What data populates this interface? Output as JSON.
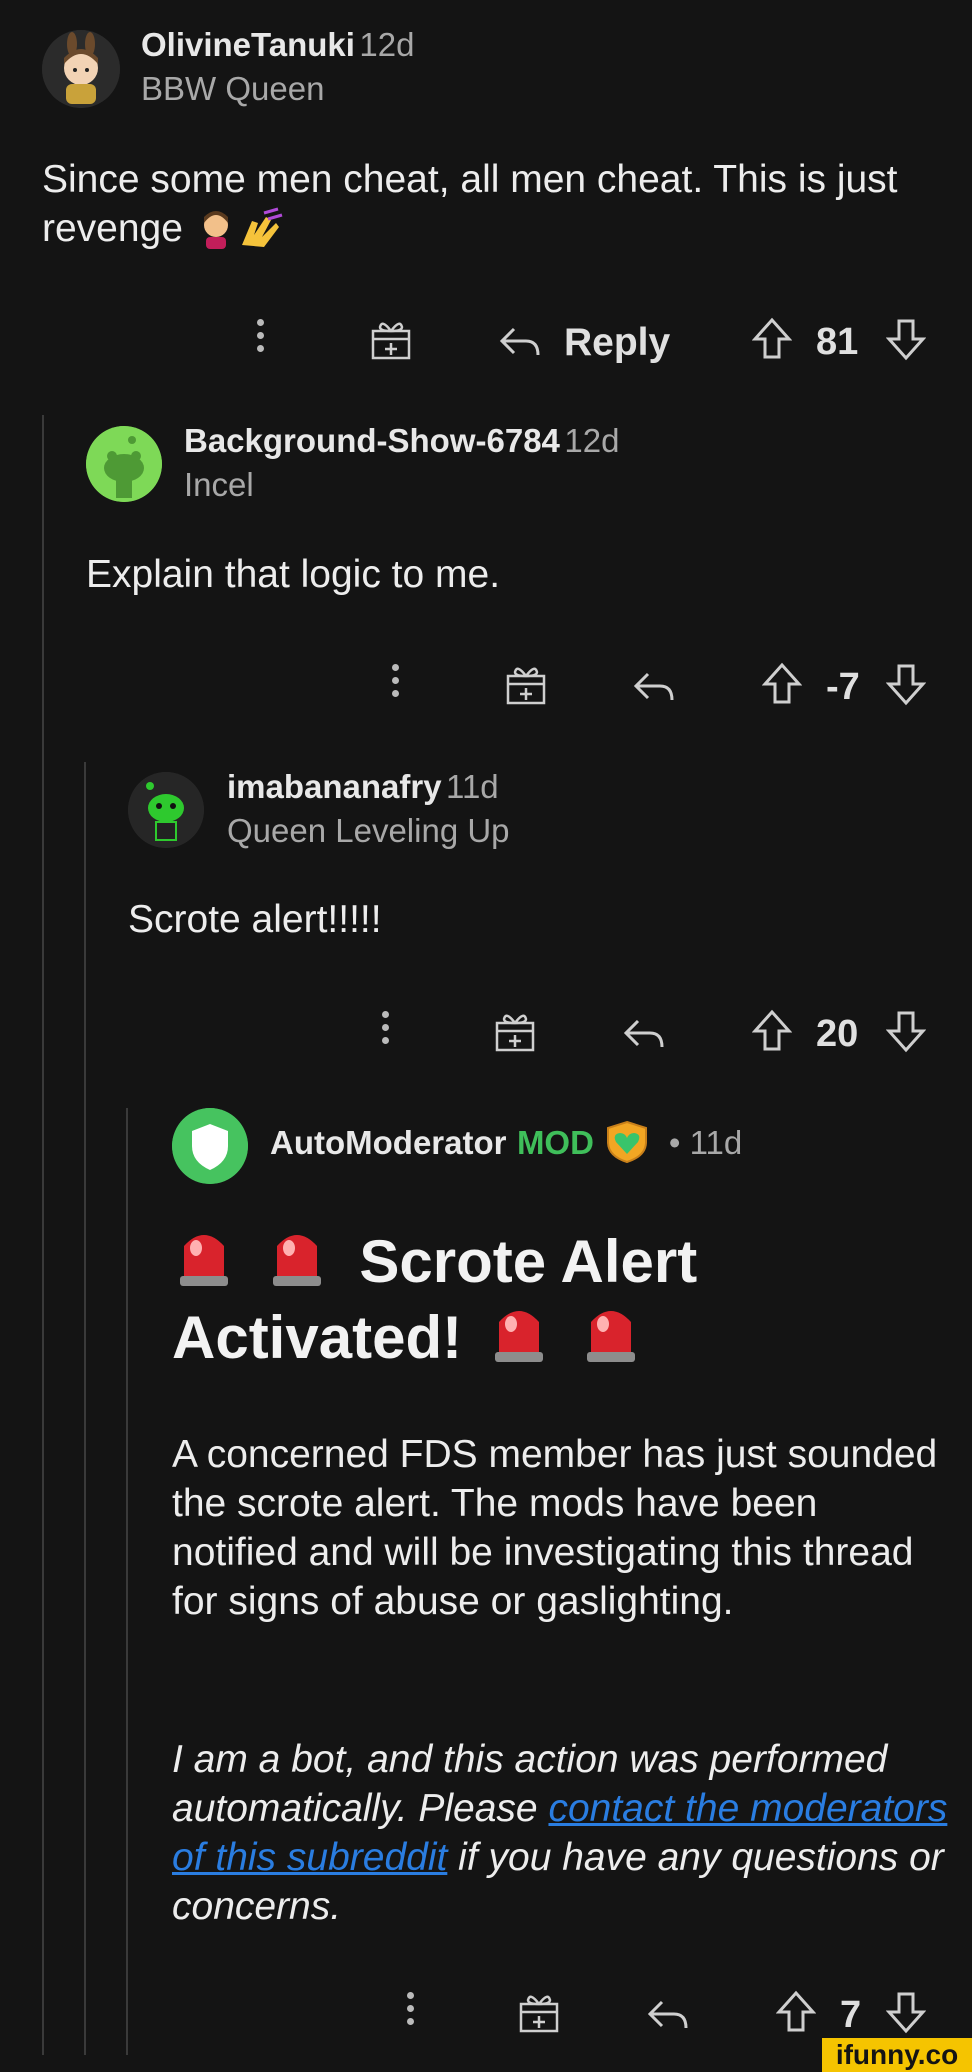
{
  "comments": [
    {
      "username": "OlivineTanuki",
      "age": "12d",
      "flair": "BBW Queen",
      "text": "Since some men cheat, all men cheat. This is just revenge",
      "reply_label": "Reply",
      "score": "81"
    },
    {
      "username": "Background-Show-6784",
      "age": "12d",
      "flair": "Incel",
      "text": "Explain that logic to me.",
      "score": "-7"
    },
    {
      "username": "imabananafry",
      "age": "11d",
      "flair": "Queen Leveling Up",
      "text": "Scrote alert!!!!!",
      "score": "20"
    },
    {
      "username": "AutoModerator",
      "mod_label": "MOD",
      "age": "• 11d",
      "title_line1": "Scrote Alert",
      "title_line2": "Activated!",
      "paragraph": "A concerned FDS member has just sounded the scrote alert. The mods have been notified and will be investigating this thread for signs of abuse or gaslighting.",
      "bot_prefix": "I am a bot, and this action was performed automatically. Please ",
      "bot_link": "contact the moderators of this subreddit",
      "bot_suffix": " if you have any questions or concerns.",
      "score": "7"
    }
  ],
  "watermark": "ifunny.co",
  "colors": {
    "background": "#141414",
    "mod_green": "#3fbf5a",
    "link_blue": "#2a7de1",
    "watermark_yellow": "#f5c400"
  }
}
